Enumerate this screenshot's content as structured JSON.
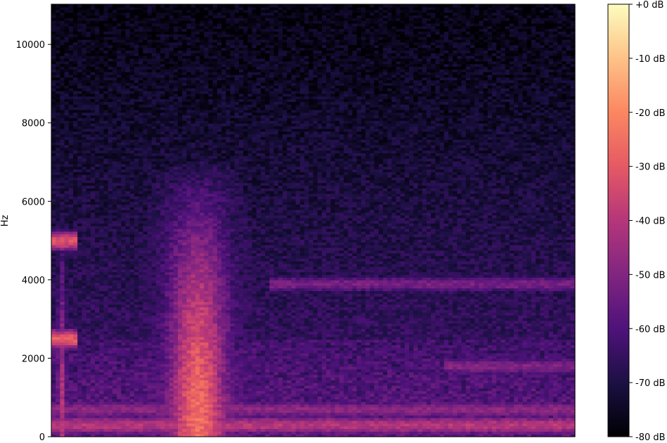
{
  "chart_data": {
    "type": "heatmap",
    "title": "",
    "xlabel": "",
    "ylabel": "Hz",
    "ylim": [
      0,
      11025
    ],
    "y_ticks": [
      0,
      2000,
      4000,
      6000,
      8000,
      10000
    ],
    "y_tick_labels": [
      "0",
      "2000",
      "4000",
      "6000",
      "8000",
      "10000"
    ],
    "x_ticks": [],
    "grid": false,
    "colormap": "magma",
    "colorbar": {
      "range": [
        -80,
        0
      ],
      "ticks": [
        0,
        -10,
        -20,
        -30,
        -40,
        -50,
        -60,
        -70,
        -80
      ],
      "tick_labels": [
        "+0 dB",
        "-10 dB",
        "-20 dB",
        "-30 dB",
        "-40 dB",
        "-50 dB",
        "-60 dB",
        "-70 dB",
        "-80 dB"
      ]
    },
    "time_frames": 120,
    "freq_bins": 160,
    "features": [
      {
        "kind": "burst",
        "center": 0.02,
        "width": 0.012,
        "fmax": 7000,
        "peak_db": -40
      },
      {
        "kind": "burst",
        "center": 0.28,
        "width": 0.06,
        "fmax": 7100,
        "peak_db": -25
      },
      {
        "kind": "band",
        "freq": 2500,
        "t0": 0.0,
        "t1": 0.05,
        "db": -30
      },
      {
        "kind": "band",
        "freq": 5000,
        "t0": 0.0,
        "t1": 0.05,
        "db": -32
      },
      {
        "kind": "band",
        "freq": 3900,
        "t0": 0.42,
        "t1": 1.0,
        "db": -52
      },
      {
        "kind": "band",
        "freq": 1800,
        "t0": 0.75,
        "t1": 1.0,
        "db": -50
      },
      {
        "kind": "band",
        "freq": 300,
        "t0": 0.0,
        "t1": 1.0,
        "db": -40
      },
      {
        "kind": "band",
        "freq": 700,
        "t0": 0.0,
        "t1": 1.0,
        "db": -48
      }
    ]
  }
}
